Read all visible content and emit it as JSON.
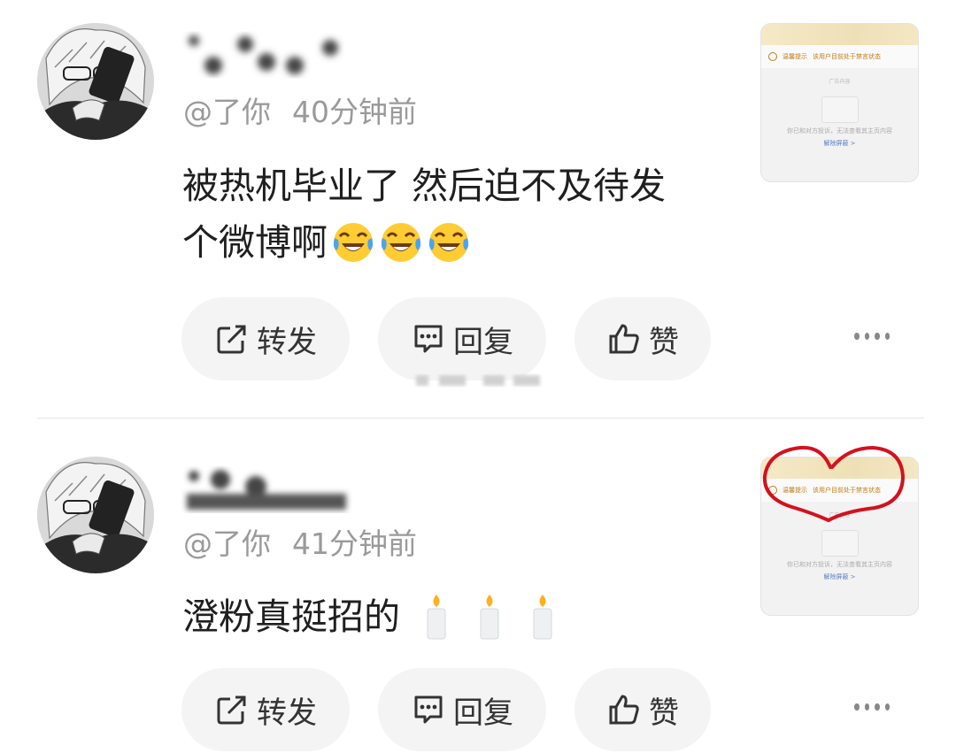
{
  "posts": [
    {
      "handle": "@了你",
      "time": "40分钟前",
      "text_line1": "被热机毕业了 然后迫不及待发",
      "text_line2": "个微博啊",
      "emojis": [
        "laughing-crying-emoji",
        "laughing-crying-emoji",
        "laughing-crying-emoji"
      ],
      "actions": {
        "repost": "转发",
        "reply": "回复",
        "like": "赞"
      }
    },
    {
      "handle": "@了你",
      "time": "41分钟前",
      "text_line1": "澄粉真挺招的",
      "emojis": [
        "candle-emoji",
        "candle-emoji",
        "candle-emoji"
      ],
      "actions": {
        "repost": "转发",
        "reply": "回复",
        "like": "赞"
      },
      "name_fragment": "狮 侬 情 深"
    }
  ],
  "thumbnail": {
    "notice_left": "温馨提示",
    "notice_right": "该用户目前处于禁言状态",
    "center_small": "广告内容",
    "footer_text": "你已和对方投诉，无法查看其主页内容",
    "link_text": "解除屏蔽 >"
  },
  "colors": {
    "annotation_red": "#d4111e",
    "handle_gray": "#9a9a9a",
    "pill_bg": "#f4f4f4"
  }
}
